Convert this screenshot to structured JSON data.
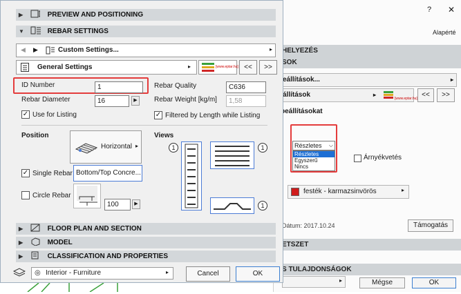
{
  "bg_dialog": {
    "help": "?",
    "close": "✕",
    "default_link": "Alapérté",
    "bars": [
      "HELYEZÉS",
      "SOK"
    ],
    "settings_btn": "eállítások...",
    "settings_btn2": "állítások",
    "brand": "[www.eptar.hu]",
    "prev": "<<",
    "next": ">>",
    "checkbox_label": "beállításokat",
    "dropdown_value": "Részletes",
    "dropdown_options": [
      "Részletes",
      "Egyszerű",
      "Nincs"
    ],
    "shadow_label": "Árnyékvetés",
    "material_label": "festék - karmazsinvörös",
    "date_label": "Dátum: 2017.10.24",
    "support_btn": "Támogatás",
    "section_bar": "ETSZET",
    "properties_bar": "S TULAJDONSÁGOK",
    "cancel_btn": "Mégse",
    "ok_btn": "OK"
  },
  "sections": {
    "preview": "PREVIEW AND POSITIONING",
    "rebar": "REBAR SETTINGS",
    "floor_plan": "FLOOR PLAN AND SECTION",
    "model": "MODEL",
    "classification": "CLASSIFICATION AND PROPERTIES"
  },
  "custom_settings": "Custom Settings...",
  "general_settings": "General Settings",
  "brand": "[www.eptar.hu]",
  "nav_prev": "<<",
  "nav_next": ">>",
  "fields": {
    "id_number_label": "ID Number",
    "id_number_value": "1",
    "rebar_diameter_label": "Rebar Diameter",
    "rebar_diameter_value": "16",
    "use_for_listing": "Use for Listing",
    "rebar_quality_label": "Rebar Quality",
    "rebar_quality_value": "C636",
    "rebar_weight_label": "Rebar Weight [kg/m]",
    "rebar_weight_value": "1,58",
    "filtered_label": "Filtered by Length while Listing"
  },
  "position": {
    "label": "Position",
    "value": "Horizontal",
    "single_rebar": "Single Rebar",
    "single_rebar_value": "Bottom/Top Concre...",
    "circle_rebar": "Circle Rebar",
    "circle_value": "100"
  },
  "views": {
    "label": "Views",
    "badge": "1"
  },
  "footer": {
    "layer": "Interior - Furniture",
    "cancel": "Cancel",
    "ok": "OK"
  },
  "colors": {
    "highlight": "#e43b3b",
    "section_bg": "#d3d7da",
    "material_swatch": "#d01c1c"
  }
}
